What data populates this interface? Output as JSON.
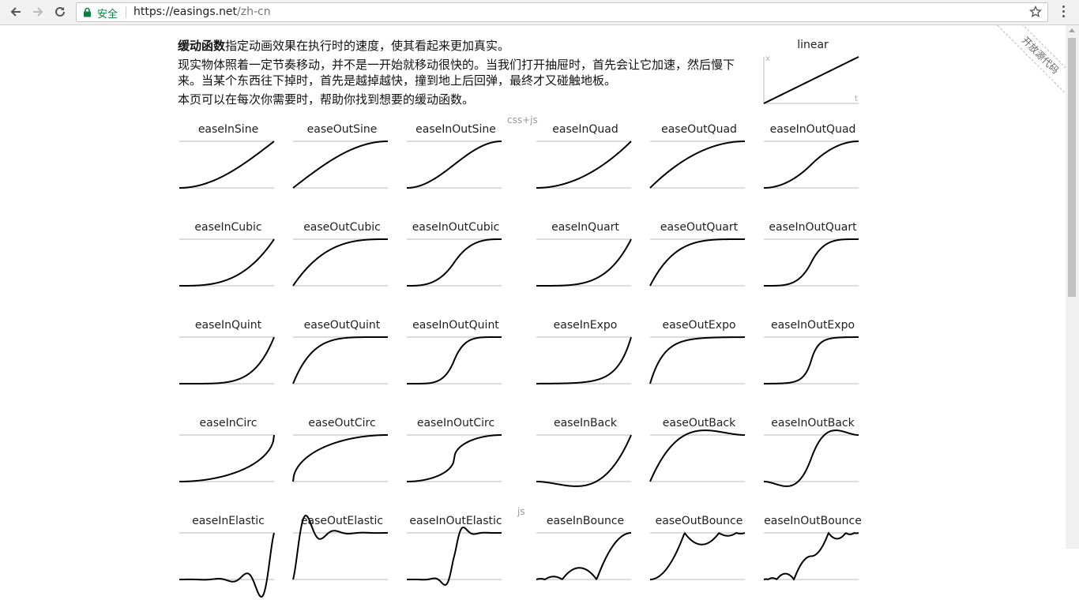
{
  "browser": {
    "secure_label": "安全",
    "url_host": "https://easings.net",
    "url_path": "/zh-cn"
  },
  "ribbon": {
    "label": "开放源代码"
  },
  "intro": {
    "term": "缓动函数",
    "line1_rest": "指定动画效果在执行时的速度，使其看起来更加真实。",
    "line2": "现实物体照着一定节奏移动，并不是一开始就移动很快的。当我们打开抽屉时，首先会让它加速，然后慢下来。当某个东西往下掉时，首先是越掉越快，撞到地上后回弹，最终才又碰触地板。",
    "line3": "本页可以在每次你需要时，帮助你找到想要的缓动函数。"
  },
  "groups": {
    "cssjs": "css+js",
    "js": "js"
  },
  "linear": {
    "name": "linear",
    "axis_x": "x",
    "axis_t": "t"
  },
  "easings": [
    {
      "name": "easeInSine",
      "fn": "easeInSine"
    },
    {
      "name": "easeOutSine",
      "fn": "easeOutSine"
    },
    {
      "name": "easeInOutSine",
      "fn": "easeInOutSine"
    },
    {
      "name": "easeInQuad",
      "fn": "easeInQuad"
    },
    {
      "name": "easeOutQuad",
      "fn": "easeOutQuad"
    },
    {
      "name": "easeInOutQuad",
      "fn": "easeInOutQuad"
    },
    {
      "name": "easeInCubic",
      "fn": "easeInCubic"
    },
    {
      "name": "easeOutCubic",
      "fn": "easeOutCubic"
    },
    {
      "name": "easeInOutCubic",
      "fn": "easeInOutCubic"
    },
    {
      "name": "easeInQuart",
      "fn": "easeInQuart"
    },
    {
      "name": "easeOutQuart",
      "fn": "easeOutQuart"
    },
    {
      "name": "easeInOutQuart",
      "fn": "easeInOutQuart"
    },
    {
      "name": "easeInQuint",
      "fn": "easeInQuint"
    },
    {
      "name": "easeOutQuint",
      "fn": "easeOutQuint"
    },
    {
      "name": "easeInOutQuint",
      "fn": "easeInOutQuint"
    },
    {
      "name": "easeInExpo",
      "fn": "easeInExpo"
    },
    {
      "name": "easeOutExpo",
      "fn": "easeOutExpo"
    },
    {
      "name": "easeInOutExpo",
      "fn": "easeInOutExpo"
    },
    {
      "name": "easeInCirc",
      "fn": "easeInCirc"
    },
    {
      "name": "easeOutCirc",
      "fn": "easeOutCirc"
    },
    {
      "name": "easeInOutCirc",
      "fn": "easeInOutCirc"
    },
    {
      "name": "easeInBack",
      "fn": "easeInBack"
    },
    {
      "name": "easeOutBack",
      "fn": "easeOutBack"
    },
    {
      "name": "easeInOutBack",
      "fn": "easeInOutBack"
    },
    {
      "name": "easeInElastic",
      "fn": "easeInElastic"
    },
    {
      "name": "easeOutElastic",
      "fn": "easeOutElastic"
    },
    {
      "name": "easeInOutElastic",
      "fn": "easeInOutElastic"
    },
    {
      "name": "easeInBounce",
      "fn": "easeInBounce"
    },
    {
      "name": "easeOutBounce",
      "fn": "easeOutBounce"
    },
    {
      "name": "easeInOutBounce",
      "fn": "easeInOutBounce"
    }
  ]
}
